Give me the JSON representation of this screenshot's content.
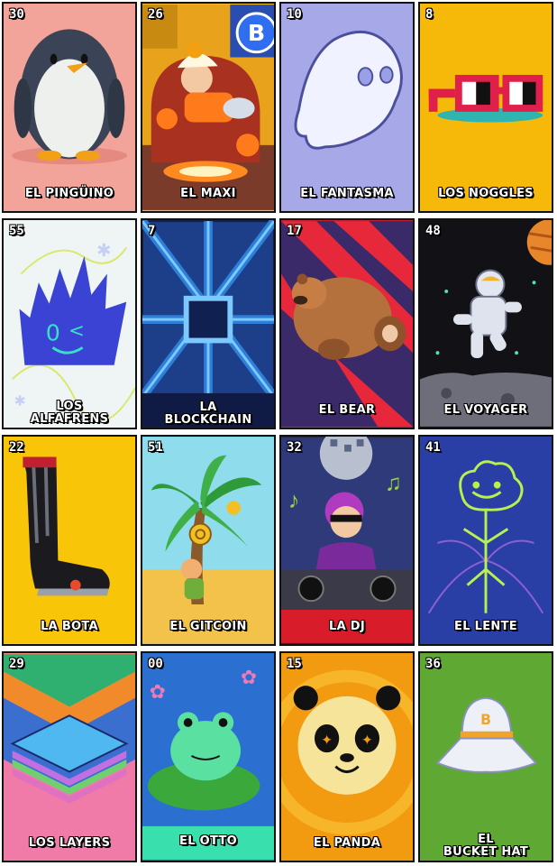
{
  "cards": [
    {
      "number": "30",
      "title": "EL PINGÜINO",
      "bg": "#f3a49a",
      "icon": "penguin-icon"
    },
    {
      "number": "26",
      "title": "EL MAXI",
      "bg": "#7a3b2a",
      "icon": "maxi-icon"
    },
    {
      "number": "10",
      "title": "EL FANTASMA",
      "bg": "#a6a8e8",
      "icon": "ghost-icon"
    },
    {
      "number": "8",
      "title": "LOS NOGGLES",
      "bg": "#f6b90a",
      "icon": "noggles-icon"
    },
    {
      "number": "55",
      "title": "LOS\nALFAFRENS",
      "bg": "#eef5f4",
      "icon": "alfafrens-icon"
    },
    {
      "number": "7",
      "title": "LA\nBLOCKCHAIN",
      "bg": "#1c2b6e",
      "icon": "blockchain-icon"
    },
    {
      "number": "17",
      "title": "EL BEAR",
      "bg": "#c32031",
      "icon": "bear-icon"
    },
    {
      "number": "48",
      "title": "EL VOYAGER",
      "bg": "#121216",
      "icon": "astronaut-icon"
    },
    {
      "number": "22",
      "title": "LA BOTA",
      "bg": "#f8c509",
      "icon": "boot-icon"
    },
    {
      "number": "51",
      "title": "EL GITCOIN",
      "bg": "#7ed3e6",
      "icon": "palm-tree-icon"
    },
    {
      "number": "32",
      "title": "LA DJ",
      "bg": "#2a2a3a",
      "icon": "dj-icon"
    },
    {
      "number": "41",
      "title": "EL LENTE",
      "bg": "#2a3fa5",
      "icon": "lens-icon"
    },
    {
      "number": "29",
      "title": "LOS LAYERS",
      "bg": "#f28a7a",
      "icon": "layers-icon"
    },
    {
      "number": "00",
      "title": "EL OTTO",
      "bg": "#2b6fd0",
      "icon": "frog-icon"
    },
    {
      "number": "15",
      "title": "EL PANDA",
      "bg": "#f29a10",
      "icon": "panda-icon"
    },
    {
      "number": "36",
      "title": "EL\nBUCKET HAT",
      "bg": "#5fa833",
      "icon": "bucket-hat-icon"
    }
  ]
}
